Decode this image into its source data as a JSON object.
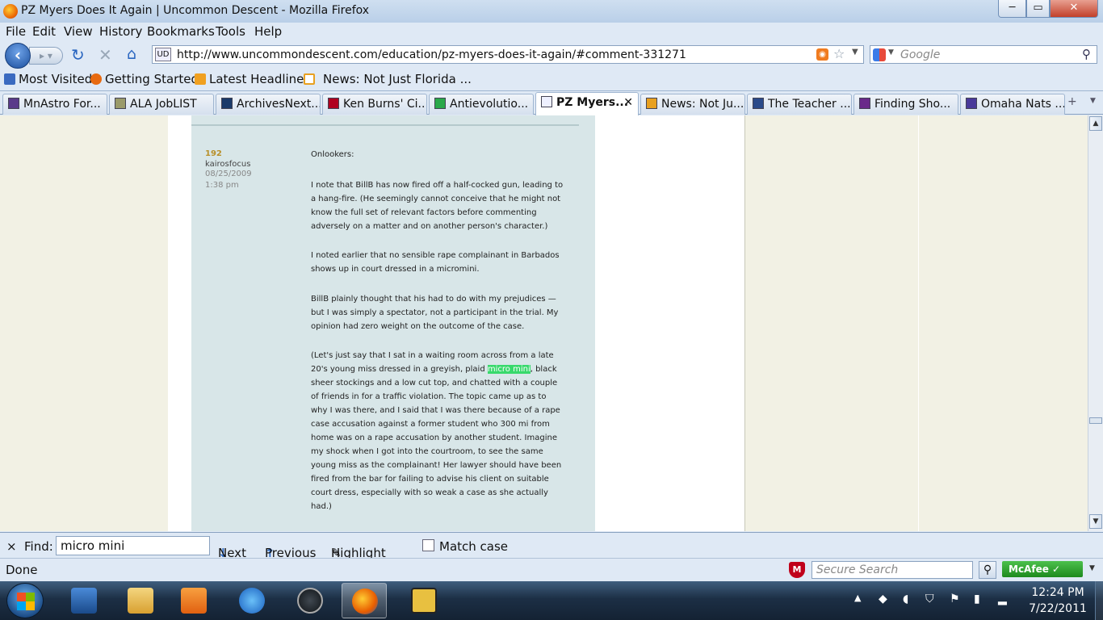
{
  "window": {
    "title": "PZ Myers Does It Again | Uncommon Descent - Mozilla Firefox",
    "min_label": "─",
    "max_label": "▭",
    "close_label": "✕"
  },
  "menu": [
    "File",
    "Edit",
    "View",
    "History",
    "Bookmarks",
    "Tools",
    "Help"
  ],
  "nav": {
    "url": "http://www.uncommondescent.com/education/pz-myers-does-it-again/#comment-331271",
    "site_icon_text": "UD",
    "search_placeholder": "Google"
  },
  "bookmarks": [
    "Most Visited",
    "Getting Started",
    "Latest Headlines",
    "News: Not Just Florida ..."
  ],
  "tabs": [
    {
      "label": "MnAstro For...",
      "icon_color": "#5a3a8a"
    },
    {
      "label": "ALA JobLIST",
      "icon_color": "#9a9a6a"
    },
    {
      "label": "ArchivesNext...",
      "icon_color": "#1a3a6a"
    },
    {
      "label": "Ken Burns' Ci...",
      "icon_color": "#b00020"
    },
    {
      "label": "Antievolutio...",
      "icon_color": "#2aa84a"
    },
    {
      "label": "PZ Myers...",
      "icon_color": "#eef0ff",
      "active": true
    },
    {
      "label": "News: Not Ju...",
      "icon_color": "#e8a020"
    },
    {
      "label": "The Teacher ...",
      "icon_color": "#2a4a8a"
    },
    {
      "label": "Finding Sho...",
      "icon_color": "#6a2a8a"
    },
    {
      "label": "Omaha Nats ...",
      "icon_color": "#4a3a9a"
    }
  ],
  "comment": {
    "number": "192",
    "author": "kairosfocus",
    "date": "08/25/2009",
    "time": "1:38 pm",
    "paragraphs": {
      "p1": "Onlookers:",
      "p2": "I note that BillB has now fired off a half-cocked gun, leading to a hang-fire. (He seemingly cannot conceive that he might not know the full set of relevant factors before commenting adversely on a matter and on another person's character.)",
      "p3": "I noted earlier that no sensible rape complainant in Barbados shows up in court dressed in a micromini.",
      "p4": "BillB plainly thought that his had to do with my prejudices — but I was simply a spectator, not a participant in the trial. My opinion had zero weight on the outcome of the case.",
      "p5_before": "(Let's just say that I sat in a waiting room across from a late 20's young miss dressed in a greyish, plaid ",
      "p5_highlight": "micro mini",
      "p5_after": ", black sheer stockings and a low cut top, and chatted with a couple of friends in for a traffic violation. The topic came up as to why I was there, and I said that I was there because of a rape case accusation against a former student who 300 mi from home was on a rape accusation by another student. Imagine my shock when I got into the courtroom, to see the same young miss as the complainant! Her lawyer should have been fired from the bar for failing to advise his client on suitable court dress, especially with so weak a case as she actually had.)"
    }
  },
  "findbar": {
    "close": "×",
    "find_label": "Find:",
    "query": "micro mini",
    "next": "Next",
    "previous": "Previous",
    "highlight": "Highlight all",
    "match_case": "Match case"
  },
  "status": {
    "text": "Done",
    "secure_search_placeholder": "Secure Search",
    "mcafee": "McAfee"
  },
  "taskbar": {
    "time": "12:24 PM",
    "date": "7/22/2011"
  }
}
